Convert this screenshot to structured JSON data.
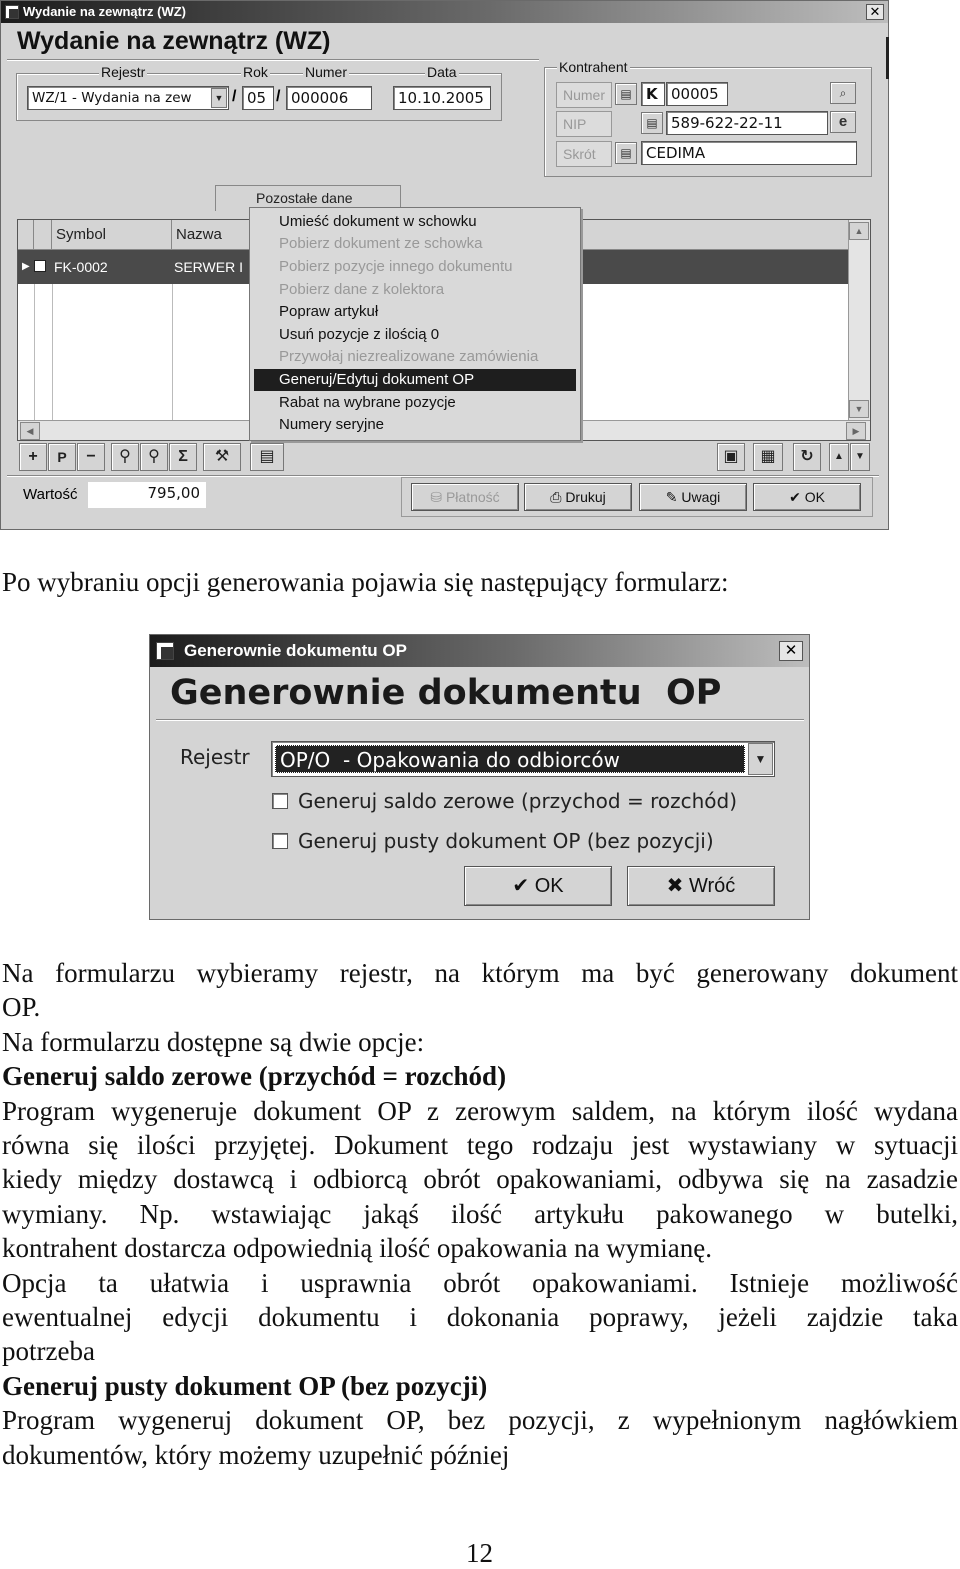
{
  "window1": {
    "title_bar": "Wydanie na zewnątrz (WZ)",
    "heading": "Wydanie na zewnątrz (WZ)",
    "labels": {
      "rejestr": "Rejestr",
      "rok": "Rok",
      "numer": "Numer",
      "data": "Data",
      "kontrahent": "Kontrahent"
    },
    "fields": {
      "rejestr_value": "WZ/1  - Wydania na zew",
      "rok_value": "05",
      "numer_value": "000006",
      "data_value": "10.10.2005",
      "separator": "/"
    },
    "kontrahent": {
      "numer_label": "Numer",
      "nip_label": "NIP",
      "skrot_label": "Skrót",
      "prefix": "K",
      "numer_value": "00005",
      "nip_value": "589-622-22-11",
      "skrot_value": "CEDIMA"
    },
    "tab_label": "Pozostałe dane",
    "grid": {
      "columns": [
        "Symbol",
        "Nazwa"
      ],
      "row": {
        "symbol": "FK-0002",
        "nazwa": "SERWER I"
      }
    },
    "context_menu": [
      {
        "label": "Umieść dokument w schowku",
        "state": "enabled"
      },
      {
        "label": "Pobierz dokument ze schowka",
        "state": "disabled"
      },
      {
        "label": "Pobierz pozycje innego dokumentu",
        "state": "disabled"
      },
      {
        "label": "Pobierz dane z kolektora",
        "state": "disabled"
      },
      {
        "label": "Popraw artykuł",
        "state": "enabled"
      },
      {
        "label": "Usuń pozycje z ilością 0",
        "state": "enabled"
      },
      {
        "label": "Przywołaj niezrealizowane zamówienia",
        "state": "disabled"
      },
      {
        "label": "Generuj/Edytuj dokument OP",
        "state": "selected"
      },
      {
        "label": "Rabat na wybrane pozycje",
        "state": "enabled"
      },
      {
        "label": "Numery seryjne",
        "state": "enabled"
      }
    ],
    "toolbar": {
      "add": "+",
      "p": "P",
      "remove": "−",
      "sigma": "Σ"
    },
    "wartosc_label": "Wartość",
    "wartosc_value": "795,00",
    "buttons": {
      "platnosc": "Płatność",
      "drukuj": "Drukuj",
      "uwagi": "Uwagi",
      "ok": "OK"
    }
  },
  "intro_text": "Po wybraniu opcji generowania pojawia się następujący formularz:",
  "dialog": {
    "title_bar": "Generownie dokumentu  OP",
    "heading": "Generownie dokumentu  OP",
    "rejestr_label": "Rejestr",
    "rejestr_value": "OP/O  - Opakowania do odbiorców",
    "option1": "Generuj saldo zerowe (przychod = rozchód)",
    "option2": "Generuj pusty dokument OP (bez pozycji)",
    "ok_label": "OK",
    "back_label": "Wróć"
  },
  "body": {
    "p1_line1": "Na formularzu wybieramy rejestr, na którym ma być generowany dokument",
    "p1_line2": "OP.",
    "p2": "Na formularzu dostępne są dwie opcje:",
    "h1": "Generuj saldo zerowe (przychód = rozchód)",
    "p3_lines": [
      "Program wygeneruje dokument OP z zerowym saldem, na którym ilość wydana",
      "równa się ilości przyjętej. Dokument tego rodzaju jest wystawiany w sytuacji",
      "kiedy między dostawcą i odbiorcą obrót opakowaniami, odbywa się na zasadzie",
      "wymiany. Np. wstawiając jakąś ilość artykułu pakowanego w butelki,",
      "kontrahent dostarcza odpowiednią ilość opakowania na wymianę."
    ],
    "p4_lines": [
      "Opcja ta ułatwia i usprawnia obrót opakowaniami. Istnieje możliwość",
      "ewentualnej edycji dokumentu i dokonania poprawy, jeżeli zajdzie taka",
      "potrzeba"
    ],
    "h2": "Generuj pusty dokument OP (bez pozycji)",
    "p5_lines": [
      "Program wygeneruj dokument OP, bez pozycji, z wypełnionym nagłówkiem",
      "dokumentów, który możemy uzupełnić później"
    ],
    "page_number": "12"
  }
}
